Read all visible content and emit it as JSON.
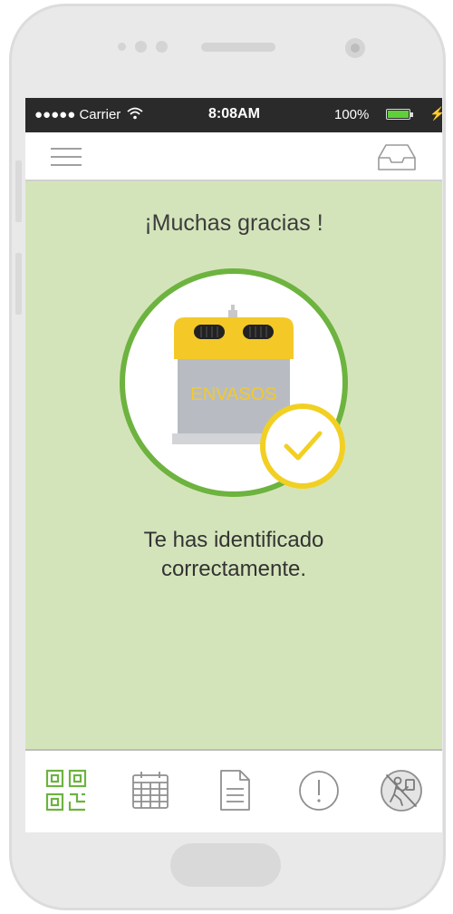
{
  "status_bar": {
    "carrier": "●●●●● Carrier",
    "time": "8:08AM",
    "battery": "100%",
    "battery_level": 1.0
  },
  "main": {
    "title": "¡Muchas gracias !",
    "container_label": "ENVASOS",
    "message_line1": "Te has identificado",
    "message_line2": "correctamente."
  },
  "tabs": [
    {
      "icon": "qr-code-icon",
      "active": true
    },
    {
      "icon": "calendar-icon",
      "active": false
    },
    {
      "icon": "document-icon",
      "active": false
    },
    {
      "icon": "alert-icon",
      "active": false
    },
    {
      "icon": "recycling-man-icon",
      "active": false
    }
  ],
  "colors": {
    "background_green": "#d4e4ba",
    "accent_green": "#6db33f",
    "container_yellow": "#f4c927",
    "check_yellow": "#f2d023",
    "status_bar": "#2a2a2a"
  }
}
